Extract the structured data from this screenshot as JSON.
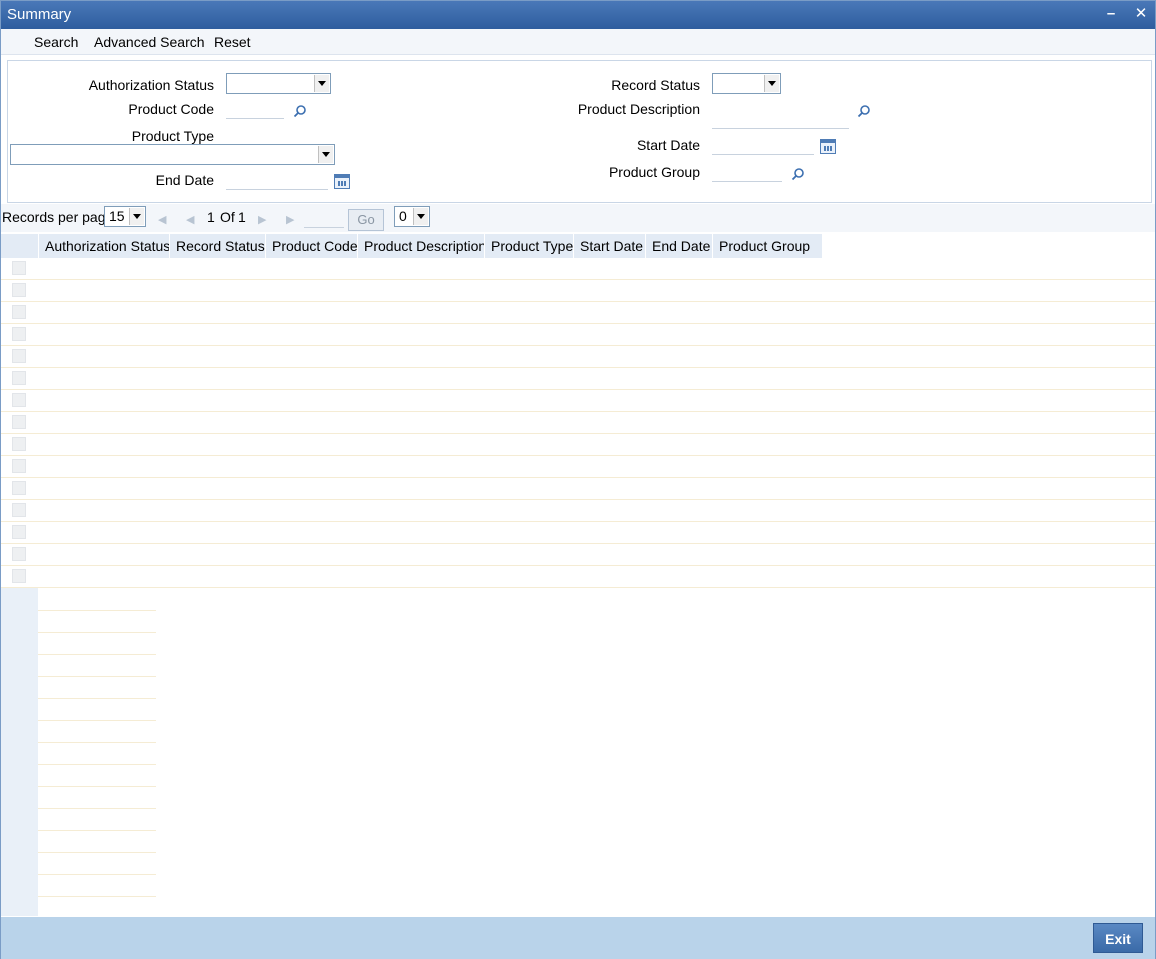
{
  "window": {
    "title": "Summary"
  },
  "toolbar": {
    "search": "Search",
    "advanced_search": "Advanced Search",
    "reset": "Reset"
  },
  "criteria": {
    "authorization_status": "Authorization Status",
    "record_status": "Record Status",
    "product_code": "Product Code",
    "product_description": "Product Description",
    "product_type": "Product Type",
    "start_date": "Start Date",
    "end_date": "End Date",
    "product_group": "Product Group"
  },
  "pager": {
    "records_per_page_label": "Records per page",
    "records_per_page_value": "15",
    "page_current": "1",
    "page_of": "Of",
    "page_total": "1",
    "go": "Go",
    "selector_value": "0"
  },
  "grid": {
    "columns": [
      "Authorization Status",
      "Record Status",
      "Product Code",
      "Product Description",
      "Product Type",
      "Start Date",
      "End Date",
      "Product Group"
    ]
  },
  "footer": {
    "exit": "Exit"
  },
  "colors": {
    "titlebar": "#2e5d9e",
    "header_bg": "#e3ebf5",
    "footer_bg": "#b9d3ea",
    "button": "#3a6aa8"
  }
}
